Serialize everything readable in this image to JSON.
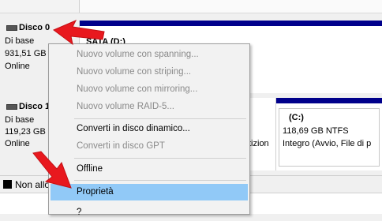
{
  "disk0": {
    "name": "Disco 0",
    "type": "Di base",
    "size": "931,51 GB",
    "status": "Online",
    "partition_label": "SATA (D:)"
  },
  "disk1": {
    "name": "Disco 1",
    "type": "Di base",
    "size": "119,23 GB",
    "status": "Online",
    "partition_c_label": "(C:)",
    "partition_c_size": "118,69 GB NTFS",
    "partition_c_status": "Integro (Avvio, File di p",
    "partition_mid_fragment": "tizion"
  },
  "legend": {
    "unallocated": "Non allo"
  },
  "context_menu": {
    "items": [
      "Nuovo volume con spanning...",
      "Nuovo volume con striping...",
      "Nuovo volume con mirroring...",
      "Nuovo volume RAID-5...",
      "Converti in disco dinamico...",
      "Converti in disco GPT",
      "Offline",
      "Proprietà",
      "?"
    ]
  },
  "colors": {
    "partition_bar": "#00008b",
    "menu_highlight": "#91c9f7",
    "arrow": "#e8181e"
  },
  "icons": [
    "disk-icon",
    "red-pointer-arrow"
  ]
}
